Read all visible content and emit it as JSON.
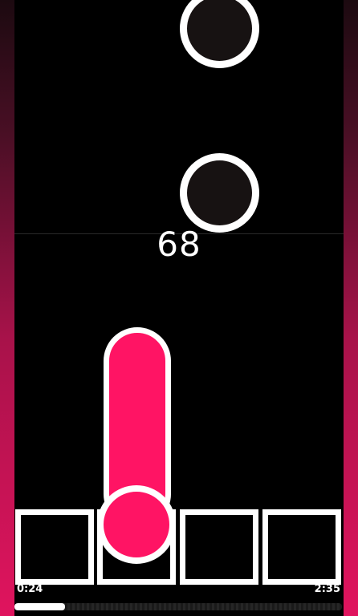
{
  "game": {
    "score": "68",
    "accent_color": "#ff1464",
    "lane_count": 4
  },
  "notes": [
    {
      "type": "tap",
      "lane": 3
    },
    {
      "type": "tap",
      "lane": 3
    },
    {
      "type": "hold",
      "lane": 2
    }
  ],
  "playback": {
    "current_time": "0:24",
    "total_time": "2:35",
    "progress_fraction": 0.155
  }
}
